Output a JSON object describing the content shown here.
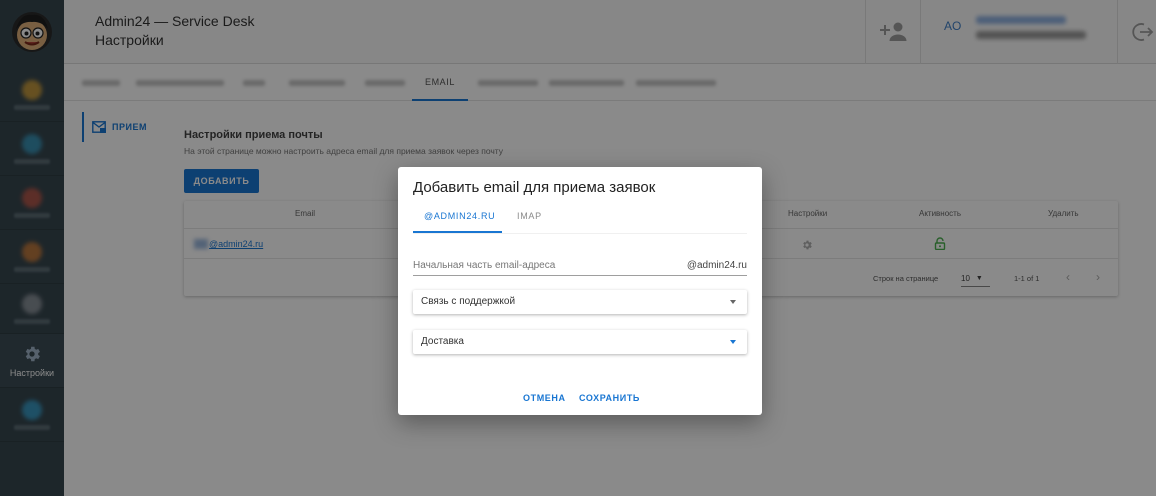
{
  "header": {
    "title": "Admin24 — Service Desk",
    "subtitle": "Настройки",
    "user_initials": "AO"
  },
  "sidebar": {
    "active_label": "Настройки"
  },
  "tabs": {
    "active_label": "EMAIL"
  },
  "inner_nav": {
    "receive_label": "ПРИЕМ"
  },
  "section": {
    "title": "Настройки приема почты",
    "description": "На этой странице можно настроить адреса email для приема заявок через почту",
    "add_button": "ДОБАВИТЬ"
  },
  "table": {
    "headers": {
      "email": "Email",
      "settings": "Настройки",
      "activity": "Активность",
      "delete": "Удалить"
    },
    "row": {
      "email_visible": "@admin24.ru"
    },
    "pagination": {
      "rows_per_page_label": "Строк на странице",
      "rows_per_page_value": "10",
      "range": "1-1 of 1"
    }
  },
  "dialog": {
    "title": "Добавить email для приема заявок",
    "tab_domain": "@ADMIN24.RU",
    "tab_imap": "IMAP",
    "input_placeholder": "Начальная часть email-адреса",
    "input_suffix": "@admin24.ru",
    "select1_value": "Связь с поддержкой",
    "select2_value": "Доставка",
    "cancel_button": "ОТМЕНА",
    "save_button": "СОХРАНИТЬ"
  },
  "colors": {
    "accent": "#1976d2",
    "sidebar_bg": "#37474f",
    "active_lock": "#4caf50"
  }
}
